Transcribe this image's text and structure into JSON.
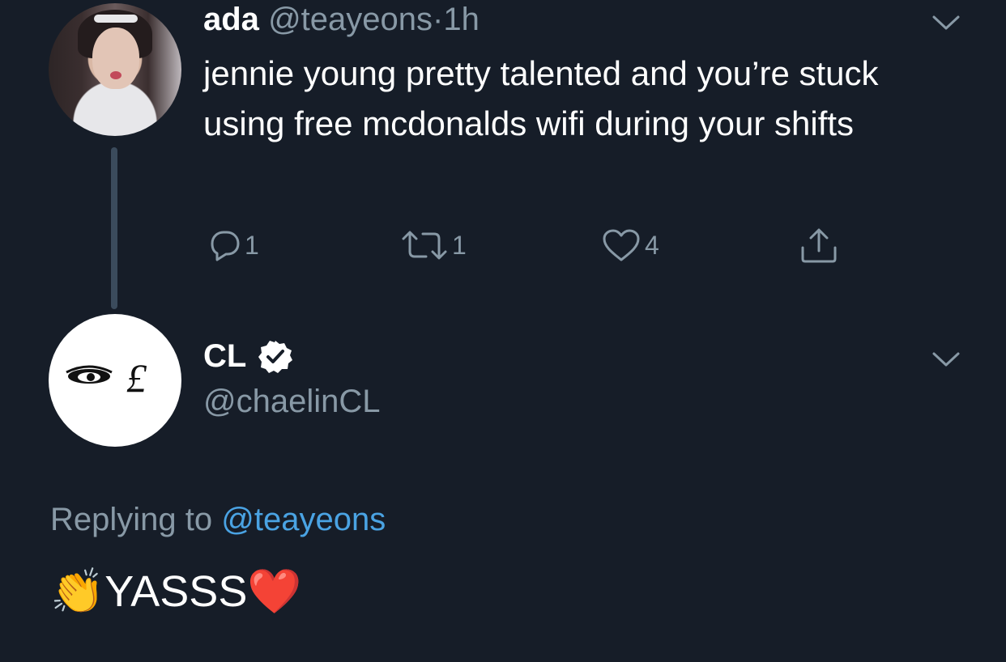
{
  "tweet": {
    "author": {
      "name": "ada",
      "handle": "@teayeons",
      "separator": "·",
      "time": "1h"
    },
    "text": "jennie young pretty talented and you’re stuck using free mcdonalds wifi during your shifts",
    "actions": {
      "replies": "1",
      "retweets": "1",
      "likes": "4"
    }
  },
  "reply": {
    "author": {
      "name": "CL",
      "handle": "@chaelinCL",
      "verified": true
    },
    "replying_prefix": "Replying to",
    "replying_to": "@teayeons",
    "text_emoji_start": "👏",
    "text": "YASSS",
    "text_emoji_end": "❤️"
  },
  "colors": {
    "background": "#161d28",
    "muted": "#8899a6",
    "link": "#4aa3e3",
    "thread_line": "#3b4b5c"
  },
  "icons": [
    "chevron-down-icon",
    "reply-icon",
    "retweet-icon",
    "heart-icon",
    "share-icon",
    "verified-badge-icon"
  ]
}
